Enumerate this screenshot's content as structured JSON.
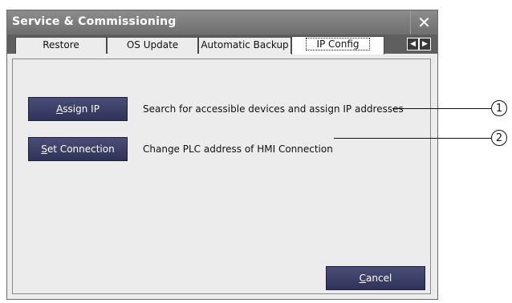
{
  "window": {
    "title": "Service & Commissioning",
    "close_glyph": "✕"
  },
  "tabs": [
    {
      "label": "Restore"
    },
    {
      "label": "OS Update"
    },
    {
      "label": "Automatic Backup"
    },
    {
      "label": "IP Config"
    }
  ],
  "tab_scroll": {
    "left_glyph": "◀",
    "right_glyph": "▶"
  },
  "actions": [
    {
      "button_mnemonic": "A",
      "button_rest": "ssign IP",
      "description": "Search for accessible devices and assign IP addresses",
      "callout": "1"
    },
    {
      "button_mnemonic": "S",
      "button_rest": "et Connection",
      "description": "Change PLC address of HMI Connection",
      "callout": "2"
    }
  ],
  "cancel": {
    "mnemonic": "C",
    "rest": "ancel"
  },
  "colors": {
    "titlebar": "#7a7a7a",
    "tabbar": "#5f5f5f",
    "button": "#3a3e66",
    "panel": "#ececec"
  }
}
